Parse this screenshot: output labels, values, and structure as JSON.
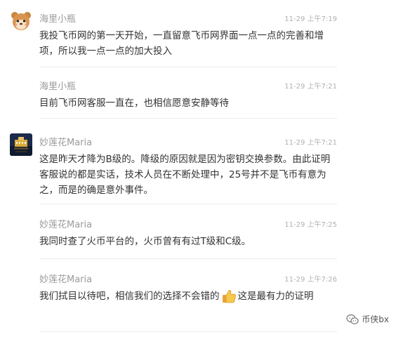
{
  "comments": [
    {
      "name": "海里小瓶",
      "time": "11-29 上午7:19",
      "avatar": "cartoon-bear-avatar",
      "text": "我投飞币网的第一天开始，一直留意飞币网界面一点一点的完善和增项，所以我一点一点的加大投入"
    },
    {
      "name": "海里小瓶",
      "time": "11-29 上午7:21",
      "text": "目前飞币网客服一直在，也相信愿意安静等待"
    },
    {
      "name": "妙莲花Maria",
      "time": "11-29 上午7:21",
      "avatar": "night-building-avatar",
      "text": "这是昨天才降为B级的。降级的原因就是因为密钥交换参数。由此证明客服说的都是实话，技术人员在不断处理中，25号并不是飞币有意为之，而是的确是意外事件。"
    },
    {
      "name": "妙莲花Maria",
      "time": "11-29 上午7:25",
      "text": "我同时查了火币平台的，火币曾有有过T级和C级。"
    },
    {
      "name": "妙莲花Maria",
      "time": "11-29 上午7:26",
      "text_before": "我们拭目以待吧，相信我们的选择不会错的",
      "emoji": "thumbs-up-icon",
      "text_after": "这是最有力的证明"
    }
  ],
  "watermark": {
    "label": "币侠bx",
    "icon": "wechat-chat-icon"
  },
  "colors": {
    "name": "#9a9a9a",
    "time": "#b0b0b0",
    "text": "#333333",
    "divider": "#ececec"
  }
}
